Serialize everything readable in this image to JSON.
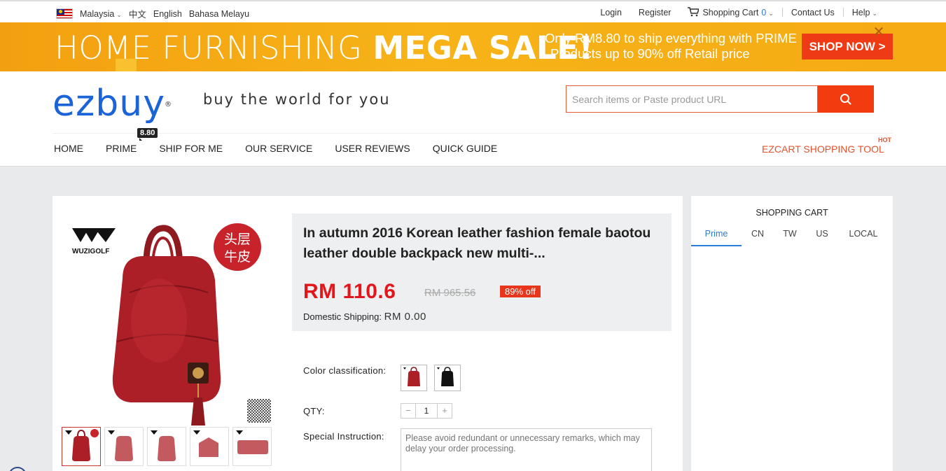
{
  "topbar": {
    "country": "Malaysia",
    "languages": [
      "中文",
      "English",
      "Bahasa Melayu"
    ],
    "login": "Login",
    "register": "Register",
    "cart_label": "Shopping Cart",
    "cart_count": "0",
    "contact": "Contact Us",
    "help": "Help"
  },
  "banner": {
    "headline_light": "HOME FURNISHING ",
    "headline_bold": "MEGA SALE!",
    "sub_line1": "Only RM8.80 to ship everything with PRIME",
    "sub_line2": "Products up to 90% off Retail price",
    "cta": "SHOP NOW >",
    "colors": {
      "background": "#f5aa14",
      "cta": "#ef3b15"
    }
  },
  "header": {
    "logo": "ezbuy",
    "tagline": "buy the world for you",
    "search_placeholder": "Search items or Paste product URL",
    "nav": [
      "HOME",
      "PRIME",
      "SHIP FOR ME",
      "OUR SERVICE",
      "USER REVIEWS",
      "QUICK GUIDE"
    ],
    "prime_badge": "8.80",
    "ezcart": "EZCART SHOPPING TOOL",
    "hot": "HOT"
  },
  "product": {
    "brand": "WUZIGOLF",
    "stamp": "头层\n牛皮",
    "title": "In autumn 2016 Korean leather fashion female baotou leather double backpack new multi-...",
    "price": "RM 110.6",
    "old_price": "RM 965.56",
    "discount": "89% off",
    "shipping_label": "Domestic Shipping:",
    "shipping_value": "RM  0.00",
    "color_label": "Color classification:",
    "qty_label": "QTY:",
    "qty_value": "1",
    "qty_minus": "−",
    "qty_plus": "+",
    "instruction_label": "Special Instruction:",
    "instruction_placeholder": "Please avoid redundant or unnecessary remarks, which may delay your order processing.",
    "colors": {
      "price": "#e3171b",
      "bag_red": "#b3222a"
    }
  },
  "cart_panel": {
    "title": "SHOPPING CART",
    "tabs": [
      "Prime",
      "CN",
      "TW",
      "US",
      "LOCAL"
    ],
    "active_tab": "Prime"
  }
}
